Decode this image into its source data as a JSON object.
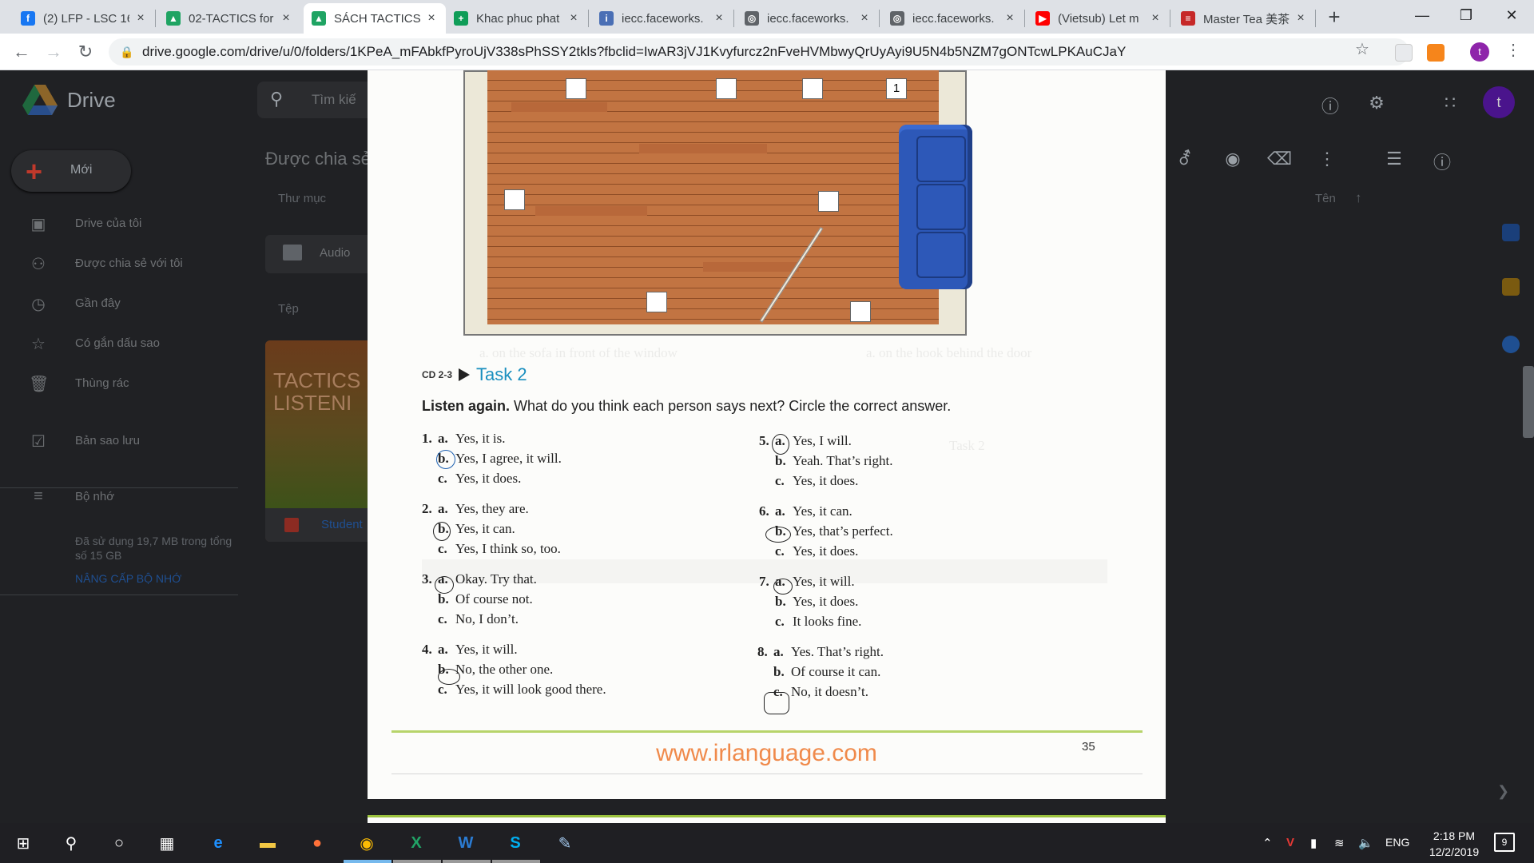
{
  "browser": {
    "tabs": [
      {
        "title": "(2) LFP - LSC 16",
        "favicon": "facebook-icon",
        "color": "#1877f2",
        "glyph": "f"
      },
      {
        "title": "02-TACTICS for",
        "favicon": "google-drive-icon",
        "color": "#1fa463",
        "glyph": "▲"
      },
      {
        "title": "SÁCH TACTICS",
        "favicon": "google-drive-icon",
        "color": "#1fa463",
        "glyph": "▲"
      },
      {
        "title": "Khac phuc phat",
        "favicon": "google-sheets-icon",
        "color": "#0f9d58",
        "glyph": "+"
      },
      {
        "title": "iecc.faceworks.",
        "favicon": "iecc-icon",
        "color": "#4a6fb5",
        "glyph": "i"
      },
      {
        "title": "iecc.faceworks.",
        "favicon": "globe-icon",
        "color": "#5f6368",
        "glyph": "◎"
      },
      {
        "title": "iecc.faceworks.",
        "favicon": "globe-icon",
        "color": "#5f6368",
        "glyph": "◎"
      },
      {
        "title": "(Vietsub) Let m",
        "favicon": "youtube-icon",
        "color": "#ff0000",
        "glyph": "▶"
      },
      {
        "title": "Master Tea 美茶",
        "favicon": "master-tea-icon",
        "color": "#c62828",
        "glyph": "≡"
      }
    ],
    "url": "drive.google.com/drive/u/0/folders/1KPeA_mFAbkfPyroUjV338sPhSSY2tkls?fbclid=IwAR3jVJ1Kvyfurcz2nFveHVMbwyQrUyAyi9U5N4b5NZM7gONTcwLPKAuCJaY",
    "profile_initial": "t"
  },
  "drive": {
    "app_name": "Drive",
    "search_placeholder": "Tìm kiế",
    "new_label": "Mới",
    "sidebar": [
      {
        "label": "Drive của tôi",
        "icon": "my-drive-icon",
        "glyph": "▣"
      },
      {
        "label": "Được chia sẻ với tôi",
        "icon": "shared-icon",
        "glyph": "⚇"
      },
      {
        "label": "Gần đây",
        "icon": "clock-icon",
        "glyph": "◷"
      },
      {
        "label": "Có gắn dấu sao",
        "icon": "star-icon",
        "glyph": "☆"
      },
      {
        "label": "Thùng rác",
        "icon": "trash-icon",
        "glyph": "🗑"
      },
      {
        "label": "Bản sao lưu",
        "icon": "backup-icon",
        "glyph": "☑"
      },
      {
        "label": "Bộ nhớ",
        "icon": "storage-icon",
        "glyph": "≡"
      }
    ],
    "storage_text": "Đã sử dụng 19,7 MB trong tổng số 15 GB",
    "upgrade_label": "NÂNG CẤP BỘ NHỚ",
    "breadcrumb": "Được chia sẻ",
    "folders_label": "Thư mục",
    "files_label": "Tệp",
    "folder_name": "Audio",
    "file_thumb_title": "TACTICS LISTENI",
    "file_name": "Student",
    "sort_label": "Tên",
    "profile_initial": "t"
  },
  "document": {
    "room_markers": [
      "",
      "",
      "",
      "1",
      "",
      "",
      "",
      ""
    ],
    "cd_label": "CD 2-3",
    "task_title": "Task 2",
    "instruction_bold": "Listen again.",
    "instruction_rest": " What do you think each person says next? Circle the correct answer.",
    "questions": [
      {
        "num": "1.",
        "options": [
          {
            "letter": "a.",
            "text": "Yes, it is."
          },
          {
            "letter": "b.",
            "text": "Yes, I agree, it will."
          },
          {
            "letter": "c.",
            "text": "Yes, it does."
          }
        ]
      },
      {
        "num": "2.",
        "options": [
          {
            "letter": "a.",
            "text": "Yes, they are."
          },
          {
            "letter": "b.",
            "text": "Yes, it can."
          },
          {
            "letter": "c.",
            "text": "Yes, I think so, too."
          }
        ]
      },
      {
        "num": "3.",
        "options": [
          {
            "letter": "a.",
            "text": "Okay. Try that."
          },
          {
            "letter": "b.",
            "text": "Of course not."
          },
          {
            "letter": "c.",
            "text": "No, I don’t."
          }
        ]
      },
      {
        "num": "4.",
        "options": [
          {
            "letter": "a.",
            "text": "Yes, it will."
          },
          {
            "letter": "b.",
            "text": "No, the other one."
          },
          {
            "letter": "c.",
            "text": "Yes, it will look good there."
          }
        ]
      },
      {
        "num": "5.",
        "options": [
          {
            "letter": "a.",
            "text": "Yes, I will."
          },
          {
            "letter": "b.",
            "text": "Yeah. That’s right."
          },
          {
            "letter": "c.",
            "text": "Yes, it does."
          }
        ]
      },
      {
        "num": "6.",
        "options": [
          {
            "letter": "a.",
            "text": "Yes, it can."
          },
          {
            "letter": "b.",
            "text": "Yes, that’s perfect."
          },
          {
            "letter": "c.",
            "text": "Yes, it does."
          }
        ]
      },
      {
        "num": "7.",
        "options": [
          {
            "letter": "a.",
            "text": "Yes, it will."
          },
          {
            "letter": "b.",
            "text": "Yes, it does."
          },
          {
            "letter": "c.",
            "text": "It looks fine."
          }
        ]
      },
      {
        "num": "8.",
        "options": [
          {
            "letter": "a.",
            "text": "Yes. That’s right."
          },
          {
            "letter": "b.",
            "text": "Of course it can."
          },
          {
            "letter": "c.",
            "text": "No, it doesn’t."
          }
        ]
      }
    ],
    "website": "www.irlanguage.com",
    "page_number": "35"
  },
  "taskbar": {
    "time": "2:18 PM",
    "date": "12/2/2019",
    "language": "ENG",
    "notification_count": "9"
  }
}
